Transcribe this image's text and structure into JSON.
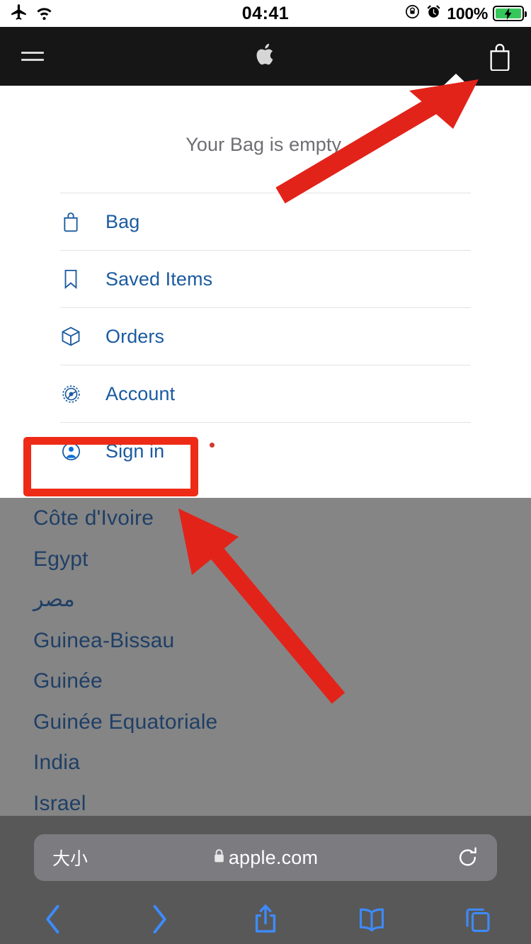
{
  "status_bar": {
    "airplane_icon": "airplane-mode-icon",
    "wifi_icon": "wifi-icon",
    "time": "04:41",
    "rotation_lock_icon": "rotation-lock-icon",
    "alarm_icon": "alarm-clock-icon",
    "battery_percent": "100%",
    "battery_icon": "battery-charging-icon",
    "battery_color": "#35c759"
  },
  "apple_nav": {
    "menu_icon": "hamburger-menu-icon",
    "logo_icon": "apple-logo-icon",
    "bag_icon": "shopping-bag-icon",
    "background": "#161617"
  },
  "bag_dropdown": {
    "empty_message": "Your Bag is empty.",
    "link_color": "#1b5ba0",
    "items": [
      {
        "label": "Bag",
        "icon": "bag-icon"
      },
      {
        "label": "Saved Items",
        "icon": "bookmark-icon"
      },
      {
        "label": "Orders",
        "icon": "box-icon"
      },
      {
        "label": "Account",
        "icon": "gear-icon"
      },
      {
        "label": "Sign in",
        "icon": "person-circle-icon"
      }
    ]
  },
  "annotations": {
    "highlight_color": "#ee2b16",
    "highlight_target": "Sign in",
    "arrow_1_target": "shopping-bag-icon",
    "arrow_2_target": "sign-in-row"
  },
  "country_page": {
    "background": "#858585",
    "items": [
      "Côte d'Ivoire",
      "Egypt",
      "مصر",
      "Guinea-Bissau",
      "Guinée",
      "Guinée Equatoriale",
      "India",
      "Israel"
    ]
  },
  "safari": {
    "text_size_label": "大小",
    "lock_icon": "lock-icon",
    "url": "apple.com",
    "reload_icon": "reload-icon",
    "toolbar": [
      {
        "name": "back-button",
        "icon": "chevron-left-icon"
      },
      {
        "name": "forward-button",
        "icon": "chevron-right-icon"
      },
      {
        "name": "share-button",
        "icon": "share-icon"
      },
      {
        "name": "bookmarks-button",
        "icon": "book-icon"
      },
      {
        "name": "tabs-button",
        "icon": "tabs-icon"
      }
    ]
  }
}
